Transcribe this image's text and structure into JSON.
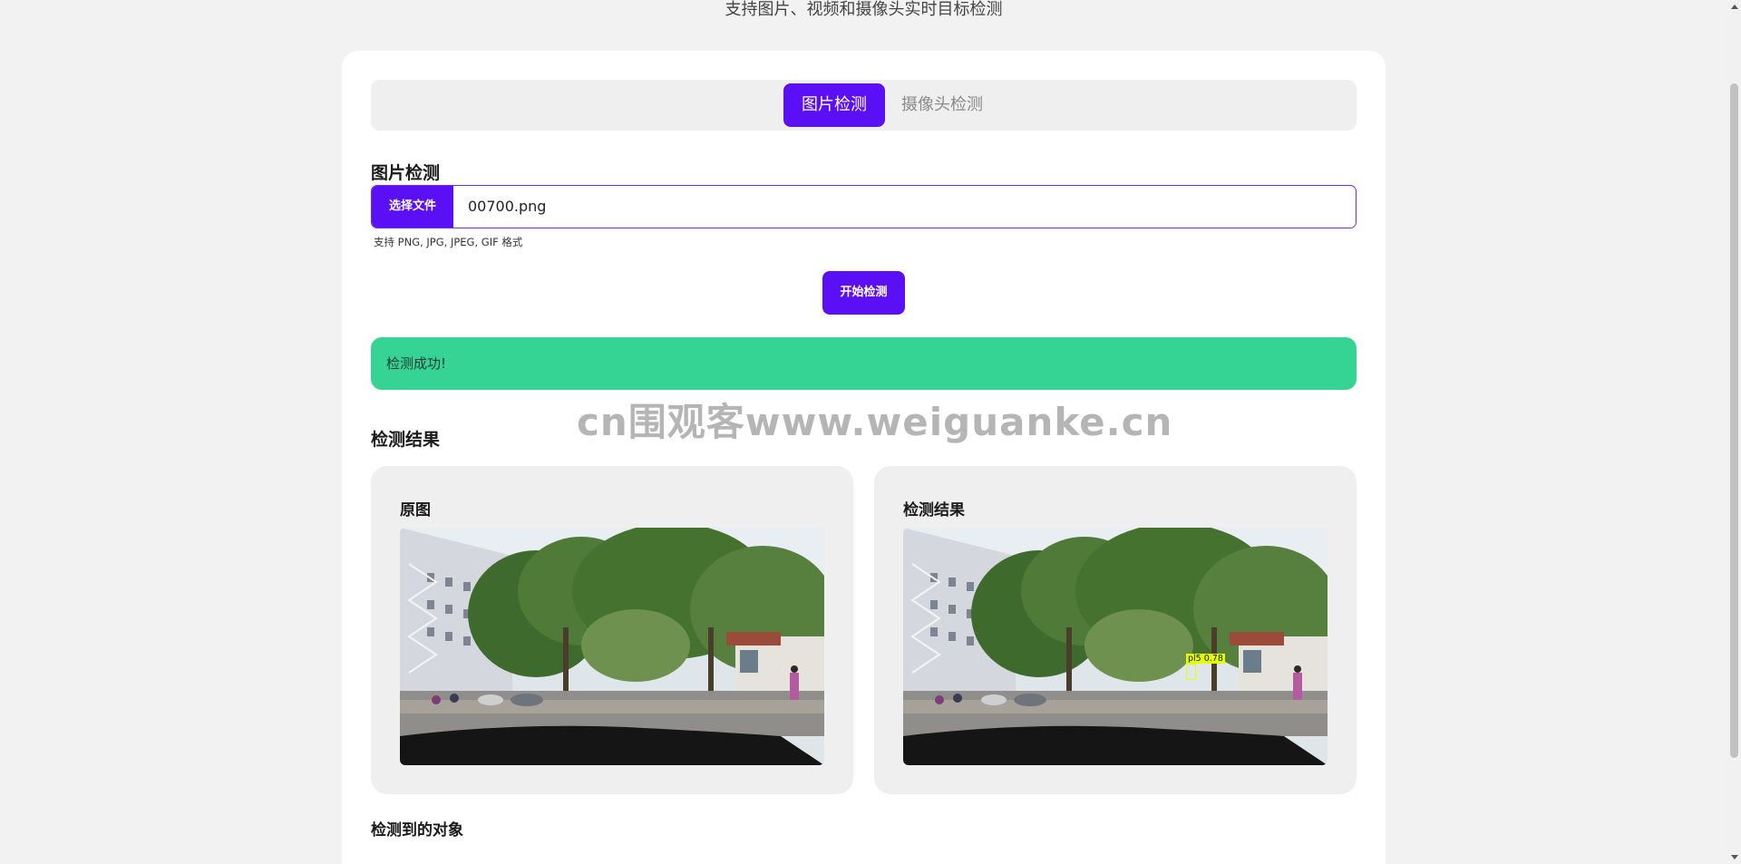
{
  "header": {
    "subtitle": "支持图片、视频和摄像头实时目标检测"
  },
  "tabs": [
    {
      "label": "图片检测",
      "active": true
    },
    {
      "label": "摄像头检测",
      "active": false
    }
  ],
  "upload": {
    "section_title": "图片检测",
    "choose_file_label": "选择文件",
    "file_name": "00700.png",
    "hint": "支持 PNG, JPG, JPEG, GIF 格式",
    "start_button_label": "开始检测"
  },
  "alert": {
    "message": "检测成功!",
    "color": "#36d494"
  },
  "results": {
    "section_title": "检测结果",
    "original_title": "原图",
    "result_title": "检测结果",
    "detection_label": "pl5 0.78",
    "objects_title": "检测到的对象"
  },
  "watermark": {
    "text": "cn围观客www.weiguanke.cn"
  },
  "colors": {
    "accent": "#5b0ff5",
    "success": "#36d494",
    "box": "#e4ff00"
  }
}
